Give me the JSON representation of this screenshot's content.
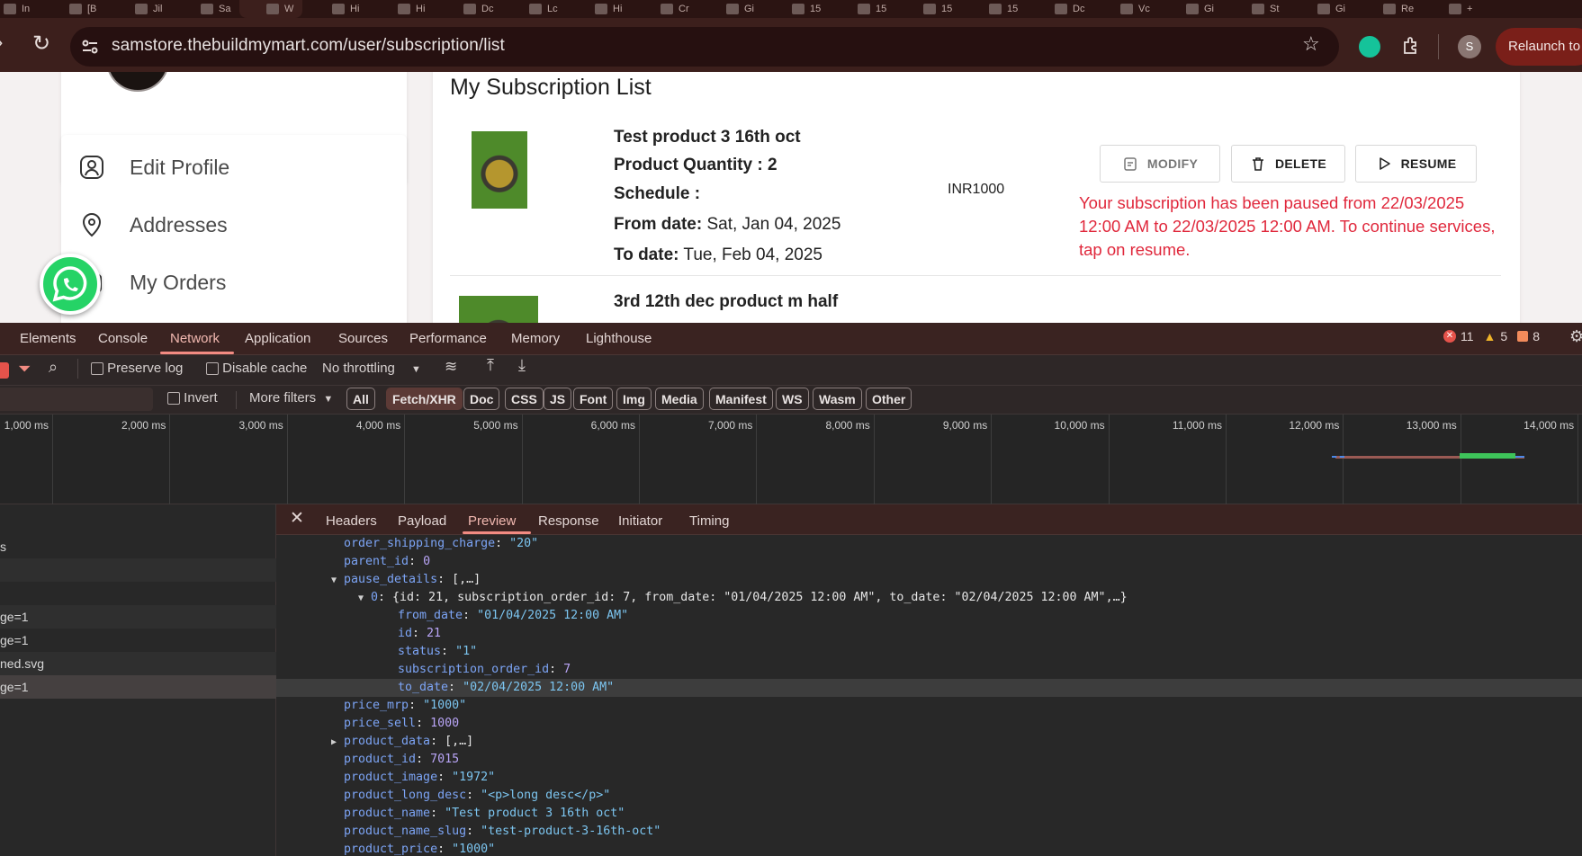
{
  "browser": {
    "tab_labels": [
      "In",
      "[B",
      "Jil",
      "Sa",
      "W",
      "Hi",
      "Hi",
      "Dc",
      "Lc",
      "Hi",
      "Cr",
      "Gi",
      "15",
      "15",
      "15",
      "15",
      "Dc",
      "Vc",
      "Gi",
      "St",
      "Gi",
      "Re",
      "+"
    ],
    "url": "samstore.thebuildmymart.com/user/subscription/list",
    "profile_initial": "S",
    "relaunch_label": "Relaunch to"
  },
  "sidebar": {
    "items": [
      {
        "label": "Edit Profile",
        "icon": "user-icon"
      },
      {
        "label": "Addresses",
        "icon": "location-pin-icon"
      },
      {
        "label": "My Orders",
        "icon": "orders-icon"
      }
    ]
  },
  "main": {
    "title": "My Subscription List",
    "subscriptions": [
      {
        "name": "Test product 3 16th oct",
        "quantity_label": "Product Quantity : 2",
        "schedule_label": "Schedule :",
        "from_label": "From date:",
        "from_value": "Sat, Jan 04, 2025",
        "to_label": "To date:",
        "to_value": "Tue, Feb 04, 2025",
        "price": "INR1000",
        "modify_label": "MODIFY",
        "delete_label": "DELETE",
        "resume_label": "RESUME",
        "pause_message": "Your subscription has been paused from 22/03/2025 12:00 AM to 22/03/2025 12:00 AM. To continue services, tap on resume."
      },
      {
        "name": "3rd 12th dec product m half"
      }
    ]
  },
  "devtools": {
    "tabs": [
      "Elements",
      "Console",
      "Network",
      "Application",
      "Sources",
      "Performance",
      "Memory",
      "Lighthouse"
    ],
    "active_tab": "Network",
    "errors": "11",
    "warnings": "5",
    "issues": "8",
    "toolbar": {
      "preserve_log": "Preserve log",
      "disable_cache": "Disable cache",
      "throttling": "No throttling"
    },
    "filters": {
      "invert": "Invert",
      "more_filters": "More filters",
      "chips": [
        "All",
        "Fetch/XHR",
        "Doc",
        "CSS",
        "JS",
        "Font",
        "Img",
        "Media",
        "Manifest",
        "WS",
        "Wasm",
        "Other"
      ],
      "active_chip": "Fetch/XHR"
    },
    "timeline_ticks": [
      "1,000 ms",
      "2,000 ms",
      "3,000 ms",
      "4,000 ms",
      "5,000 ms",
      "6,000 ms",
      "7,000 ms",
      "8,000 ms",
      "9,000 ms",
      "10,000 ms",
      "11,000 ms",
      "12,000 ms",
      "13,000 ms",
      "14,000 ms"
    ],
    "request_rows": [
      "s",
      "",
      "",
      "ge=1",
      "ge=1",
      "ned.svg",
      "ge=1"
    ],
    "detail_tabs": [
      "Headers",
      "Payload",
      "Preview",
      "Response",
      "Initiator",
      "Timing"
    ],
    "active_detail_tab": "Preview",
    "preview_lines": [
      {
        "key": "order_shipping_charge",
        "value": "\"20\"",
        "type": "s",
        "indent": 0
      },
      {
        "key": "parent_id",
        "value": "0",
        "type": "n",
        "indent": 0
      },
      {
        "key": "pause_details",
        "value": "[,…]",
        "type": "p",
        "indent": 0,
        "toggle": "open"
      },
      {
        "key": "0",
        "value": "{id: 21, subscription_order_id: 7, from_date: \"01/04/2025 12:00 AM\", to_date: \"02/04/2025 12:00 AM\",…}",
        "type": "p",
        "indent": 1,
        "toggle": "open"
      },
      {
        "key": "from_date",
        "value": "\"01/04/2025 12:00 AM\"",
        "type": "s",
        "indent": 2
      },
      {
        "key": "id",
        "value": "21",
        "type": "n",
        "indent": 2
      },
      {
        "key": "status",
        "value": "\"1\"",
        "type": "s",
        "indent": 2
      },
      {
        "key": "subscription_order_id",
        "value": "7",
        "type": "n",
        "indent": 2
      },
      {
        "key": "to_date",
        "value": "\"02/04/2025 12:00 AM\"",
        "type": "s",
        "indent": 2,
        "highlight": true
      },
      {
        "key": "price_mrp",
        "value": "\"1000\"",
        "type": "s",
        "indent": 0
      },
      {
        "key": "price_sell",
        "value": "1000",
        "type": "n",
        "indent": 0
      },
      {
        "key": "product_data",
        "value": "[,…]",
        "type": "p",
        "indent": 0,
        "toggle": "closed"
      },
      {
        "key": "product_id",
        "value": "7015",
        "type": "n",
        "indent": 0
      },
      {
        "key": "product_image",
        "value": "\"1972\"",
        "type": "s",
        "indent": 0
      },
      {
        "key": "product_long_desc",
        "value": "\"<p>long desc</p>\"",
        "type": "s",
        "indent": 0
      },
      {
        "key": "product_name",
        "value": "\"Test product 3 16th oct\"",
        "type": "s",
        "indent": 0
      },
      {
        "key": "product_name_slug",
        "value": "\"test-product-3-16th-oct\"",
        "type": "s",
        "indent": 0
      },
      {
        "key": "product_price",
        "value": "\"1000\"",
        "type": "s",
        "indent": 0
      }
    ]
  },
  "colors": {
    "accent_devtools": "#f28b82",
    "pause_message": "#e0283c",
    "whatsapp": "#25d366"
  }
}
